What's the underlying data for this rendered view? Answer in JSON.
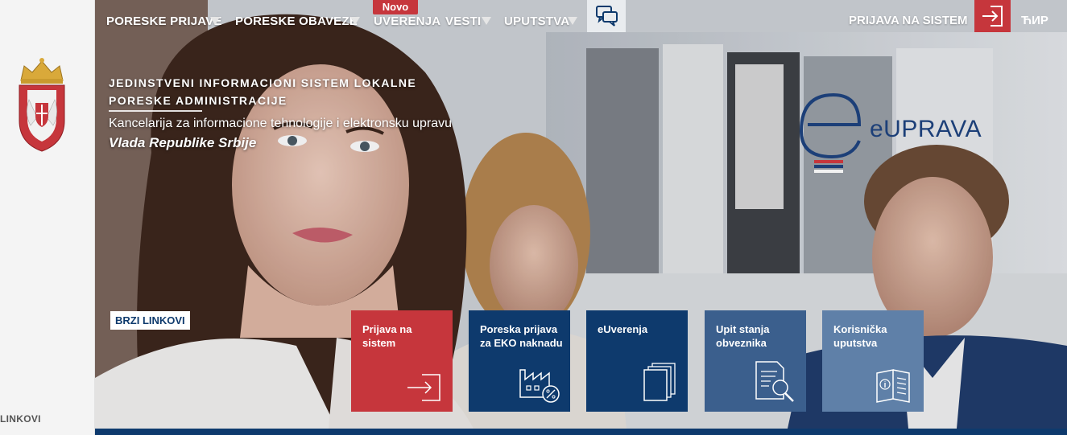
{
  "nav": {
    "items": [
      {
        "label": "PORESKE PRIJAVE",
        "has_dropdown": true
      },
      {
        "label": "PORESKE OBAVEZE",
        "has_dropdown": true
      },
      {
        "label": "UVERENJA",
        "has_dropdown": false
      },
      {
        "label": "VESTI",
        "has_dropdown": true
      },
      {
        "label": "UPUTSTVA",
        "has_dropdown": true
      }
    ],
    "novo_badge": "Novo",
    "chat_icon": "chat-bubbles-icon",
    "login_label": "PRIJAVA NA SISTEM",
    "login_icon": "login-arrow-icon",
    "script_toggle": "ЋИР"
  },
  "header": {
    "headline_line1": "JEDINSTVENI INFORMACIONI SISTEM LOKALNE",
    "headline_line2": "PORESKE ADMINISTRACIJE",
    "office": "Kancelarija za informacione tehnologije i elektronsku upravu",
    "government": "Vlada Republike Srbije",
    "eu_logo_text": "eUPRAVA"
  },
  "sidebar": {
    "links_label": "LINKOVI"
  },
  "quick_links": {
    "heading": "BRZI LINKOVI",
    "tiles": [
      {
        "label": "Prijava na sistem",
        "icon": "login-arrow-icon",
        "color": "#c6363c"
      },
      {
        "label": "Poreska prijava za EKO naknadu",
        "icon": "factory-percent-icon",
        "color": "#0e3a6d"
      },
      {
        "label": "eUverenja",
        "icon": "documents-stack-icon",
        "color": "#0e3a6d"
      },
      {
        "label": "Upit stanja obveznika",
        "icon": "document-search-icon",
        "color": "#3b5f8d"
      },
      {
        "label": "Korisnička uputstva",
        "icon": "manual-book-icon",
        "color": "#5f80a8"
      }
    ]
  },
  "colors": {
    "accent_red": "#c6363c",
    "navy": "#0e3a6d",
    "mid_blue": "#3b5f8d",
    "light_blue": "#5f80a8"
  }
}
